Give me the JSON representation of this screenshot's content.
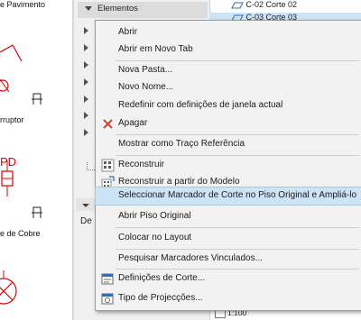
{
  "canvas": {
    "labels": [
      "e Pavimento",
      "rruptor",
      "PD",
      "e de Cobre"
    ]
  },
  "navigator": {
    "header_label": "Elementos",
    "partial_label": "De",
    "views": [
      "C-02 Corte 02",
      "C-03 Corte 03"
    ],
    "scale": "1:100"
  },
  "context_menu": {
    "items": [
      {
        "label": "Abrir",
        "icon": ""
      },
      {
        "label": "Abrir em Novo Tab",
        "icon": ""
      },
      {
        "label": "Nova Pasta...",
        "icon": ""
      },
      {
        "label": "Novo Nome...",
        "icon": ""
      },
      {
        "label": "Redefinir com definições de janela actual",
        "icon": ""
      },
      {
        "label": "Apagar",
        "icon": "delete-x-icon"
      },
      {
        "label": "Mostrar como Traço Referência",
        "icon": ""
      },
      {
        "label": "Reconstruir",
        "icon": "rebuild-icon"
      },
      {
        "label": "Reconstruir a partir do Modelo",
        "icon": "rebuild-from-model-icon"
      },
      {
        "label": "Seleccionar Marcador de Corte no Piso Original e Ampliá-lo",
        "icon": "",
        "highlighted": true
      },
      {
        "label": "Abrir Piso Original",
        "icon": ""
      },
      {
        "label": "Colocar no Layout",
        "icon": ""
      },
      {
        "label": "Pesquisar Marcadores Vinculados...",
        "icon": ""
      },
      {
        "label": "Definições de Corte...",
        "icon": "section-settings-icon"
      },
      {
        "label": "Tipo de Projecções...",
        "icon": "projection-type-icon"
      }
    ]
  },
  "colors": {
    "highlight": "#cce4f7",
    "delete_icon": "#e03c31",
    "cad_red": "#e00000"
  }
}
